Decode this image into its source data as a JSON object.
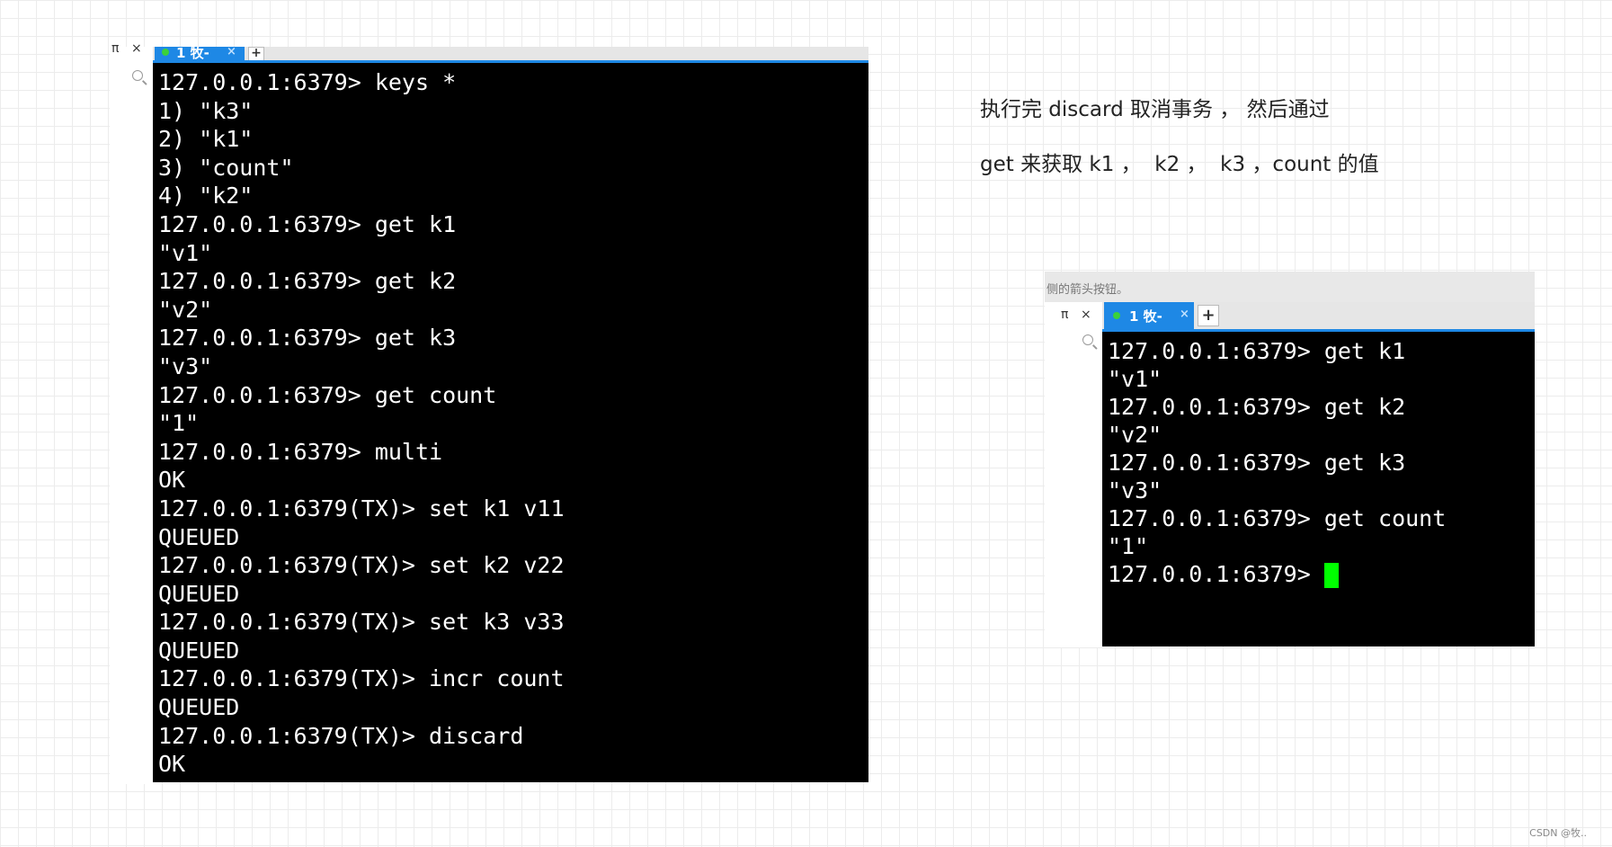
{
  "left_terminal": {
    "pin_label": "π",
    "close_label": "×",
    "tab_label": "1 牧-",
    "tab_close": "×",
    "tab_plus": "+",
    "lines": [
      "127.0.0.1:6379> keys *",
      "1) \"k3\"",
      "2) \"k1\"",
      "3) \"count\"",
      "4) \"k2\"",
      "127.0.0.1:6379> get k1",
      "\"v1\"",
      "127.0.0.1:6379> get k2",
      "\"v2\"",
      "127.0.0.1:6379> get k3",
      "\"v3\"",
      "127.0.0.1:6379> get count",
      "\"1\"",
      "127.0.0.1:6379> multi",
      "OK",
      "127.0.0.1:6379(TX)> set k1 v11",
      "QUEUED",
      "127.0.0.1:6379(TX)> set k2 v22",
      "QUEUED",
      "127.0.0.1:6379(TX)> set k3 v33",
      "QUEUED",
      "127.0.0.1:6379(TX)> incr count",
      "QUEUED",
      "127.0.0.1:6379(TX)> discard",
      "OK"
    ]
  },
  "annotation": {
    "line1": "执行完 discard 取消事务 ， 然后通过",
    "line2": "get 来获取 k1 ，  k2 ，  k3 ，count 的值"
  },
  "right_terminal": {
    "hint": "侧的箭头按钮。",
    "pin_label": "π",
    "close_label": "×",
    "tab_label": "1 牧-",
    "tab_close": "×",
    "tab_plus": "+",
    "lines": [
      "127.0.0.1:6379> get k1",
      "\"v1\"",
      "127.0.0.1:6379> get k2",
      "\"v2\"",
      "127.0.0.1:6379> get k3",
      "\"v3\"",
      "127.0.0.1:6379> get count",
      "\"1\""
    ],
    "prompt": "127.0.0.1:6379> "
  },
  "watermark": "CSDN @牧..",
  "colors": {
    "terminal_bg": "#000000",
    "terminal_fg": "#ffffff",
    "tab_active": "#1e88e5",
    "cursor": "#00ff00",
    "status_dot": "#3bd13b"
  }
}
